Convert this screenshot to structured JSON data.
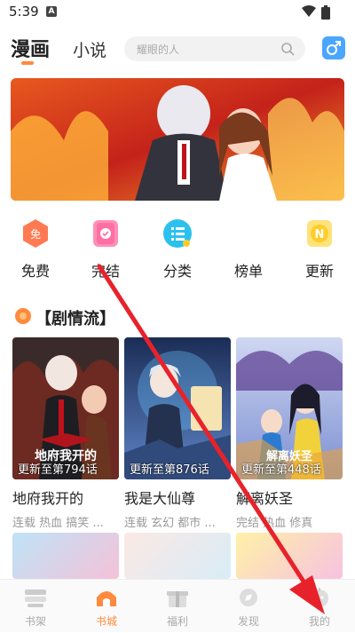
{
  "status_bar": {
    "time": "5:39",
    "notification_letter": "A"
  },
  "header": {
    "tabs": [
      {
        "label": "漫画"
      },
      {
        "label": "小说"
      }
    ],
    "search": {
      "placeholder": "耀眼的人"
    },
    "gender_icon": "male-symbol-icon"
  },
  "categories": [
    {
      "label": "免费",
      "icon_text": "免",
      "color": "#ff7a52"
    },
    {
      "label": "完结",
      "color": "#ff6fa3"
    },
    {
      "label": "分类",
      "color": "#2bc1ef"
    },
    {
      "label": "榜单"
    },
    {
      "label": "更新",
      "icon_text": "N",
      "color": "#ffcc2a"
    }
  ],
  "section": {
    "title": "【剧情流】"
  },
  "cards": [
    {
      "name": "地府我开的",
      "update": "更新至第794话",
      "tags": "连载 热血 搞笑 ...",
      "cover_text": "地府我开的"
    },
    {
      "name": "我是大仙尊",
      "update": "更新至第876话",
      "tags": "连载 玄幻 都市 ..."
    },
    {
      "name": "解离妖圣",
      "update": "更新至第448话",
      "tags": "完结 热血 修真",
      "cover_text": "解离妖圣"
    }
  ],
  "bottom_nav": [
    {
      "label": "书架"
    },
    {
      "label": "书城",
      "active": true
    },
    {
      "label": "福利"
    },
    {
      "label": "发现"
    },
    {
      "label": "我的"
    }
  ],
  "accent_color": "#ff8a3d",
  "annotation_arrow_color": "#e8222a"
}
